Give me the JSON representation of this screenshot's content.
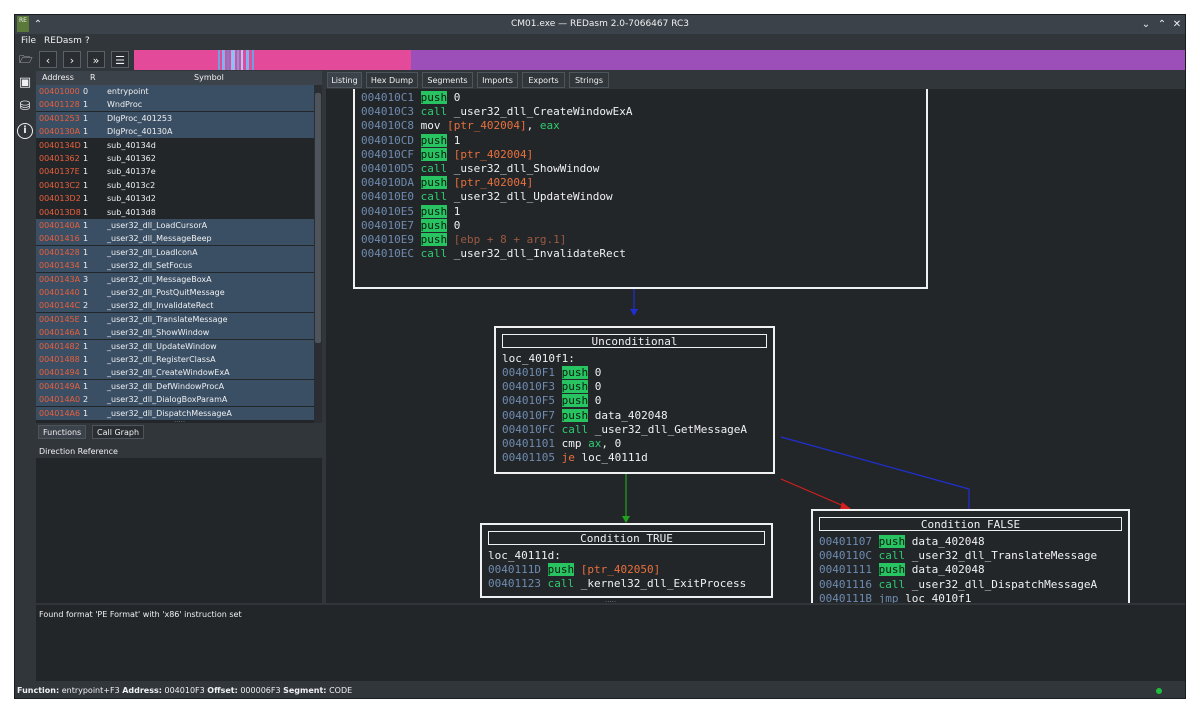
{
  "window": {
    "title": "CM01.exe — REDasm 2.0-7066467 RC3"
  },
  "menu": {
    "file": "File",
    "redasm": "REDasm",
    "help": "?"
  },
  "symbols": {
    "headers": {
      "address": "Address",
      "r": "R",
      "symbol": "Symbol"
    },
    "rows": [
      {
        "address": "00401000",
        "r": "0",
        "symbol": "entrypoint",
        "selected": true
      },
      {
        "address": "00401128",
        "r": "1",
        "symbol": "WndProc",
        "selected": true
      },
      {
        "address": "00401253",
        "r": "1",
        "symbol": "DlgProc_401253",
        "selected": true
      },
      {
        "address": "0040130A",
        "r": "1",
        "symbol": "DlgProc_40130A",
        "selected": true
      },
      {
        "address": "0040134D",
        "r": "1",
        "symbol": "sub_40134d",
        "selected": false
      },
      {
        "address": "00401362",
        "r": "1",
        "symbol": "sub_401362",
        "selected": false
      },
      {
        "address": "0040137E",
        "r": "1",
        "symbol": "sub_40137e",
        "selected": false
      },
      {
        "address": "004013C2",
        "r": "1",
        "symbol": "sub_4013c2",
        "selected": false
      },
      {
        "address": "004013D2",
        "r": "1",
        "symbol": "sub_4013d2",
        "selected": false
      },
      {
        "address": "004013D8",
        "r": "1",
        "symbol": "sub_4013d8",
        "selected": false
      },
      {
        "address": "0040140A",
        "r": "1",
        "symbol": "_user32_dll_LoadCursorA",
        "selected": true
      },
      {
        "address": "00401416",
        "r": "1",
        "symbol": "_user32_dll_MessageBeep",
        "selected": true
      },
      {
        "address": "00401428",
        "r": "1",
        "symbol": "_user32_dll_LoadIconA",
        "selected": true
      },
      {
        "address": "00401434",
        "r": "1",
        "symbol": "_user32_dll_SetFocus",
        "selected": true
      },
      {
        "address": "0040143A",
        "r": "3",
        "symbol": "_user32_dll_MessageBoxA",
        "selected": true
      },
      {
        "address": "00401440",
        "r": "1",
        "symbol": "_user32_dll_PostQuitMessage",
        "selected": true
      },
      {
        "address": "0040144C",
        "r": "2",
        "symbol": "_user32_dll_InvalidateRect",
        "selected": true
      },
      {
        "address": "0040145E",
        "r": "1",
        "symbol": "_user32_dll_TranslateMessage",
        "selected": true
      },
      {
        "address": "0040146A",
        "r": "1",
        "symbol": "_user32_dll_ShowWindow",
        "selected": true
      },
      {
        "address": "00401482",
        "r": "1",
        "symbol": "_user32_dll_UpdateWindow",
        "selected": true
      },
      {
        "address": "00401488",
        "r": "1",
        "symbol": "_user32_dll_RegisterClassA",
        "selected": true
      },
      {
        "address": "00401494",
        "r": "1",
        "symbol": "_user32_dll_CreateWindowExA",
        "selected": true
      },
      {
        "address": "0040149A",
        "r": "1",
        "symbol": "_user32_dll_DefWindowProcA",
        "selected": true
      },
      {
        "address": "004014A0",
        "r": "2",
        "symbol": "_user32_dll_DialogBoxParamA",
        "selected": true
      },
      {
        "address": "004014A6",
        "r": "1",
        "symbol": "_user32_dll_DispatchMessageA",
        "selected": true
      }
    ]
  },
  "bottom_tabs": {
    "functions": "Functions",
    "callgraph": "Call Graph"
  },
  "reference": {
    "header": "Direction Reference"
  },
  "view_tabs": {
    "listing": "Listing",
    "hexdump": "Hex Dump",
    "segments": "Segments",
    "imports": "Imports",
    "exports": "Exports",
    "strings": "Strings"
  },
  "blocks": {
    "top": {
      "lines": [
        {
          "addr": "004010C1",
          "mn": "push",
          "ops": "0",
          "kind": "plain"
        },
        {
          "addr": "004010C3",
          "mn": "call",
          "ops": "_user32_dll_CreateWindowExA",
          "kind": "plain"
        },
        {
          "addr": "004010C8",
          "mn": "mov",
          "ops": "[ptr_402004]",
          "ops2": ", ",
          "ops3": "eax",
          "kind": "mov"
        },
        {
          "addr": "004010CD",
          "mn": "push",
          "ops": "1",
          "kind": "plain"
        },
        {
          "addr": "004010CF",
          "mn": "push",
          "ops": "[ptr_402004]",
          "kind": "mem"
        },
        {
          "addr": "004010D5",
          "mn": "call",
          "ops": "_user32_dll_ShowWindow",
          "kind": "plain"
        },
        {
          "addr": "004010DA",
          "mn": "push",
          "ops": "[ptr_402004]",
          "kind": "mem"
        },
        {
          "addr": "004010E0",
          "mn": "call",
          "ops": "_user32_dll_UpdateWindow",
          "kind": "plain"
        },
        {
          "addr": "004010E5",
          "mn": "push",
          "ops": "1",
          "kind": "plain"
        },
        {
          "addr": "004010E7",
          "mn": "push",
          "ops": "0",
          "kind": "plain"
        },
        {
          "addr": "004010E9",
          "mn": "push",
          "ops": "[ebp + 8 + arg.1]",
          "kind": "cmt"
        },
        {
          "addr": "004010EC",
          "mn": "call",
          "ops": "_user32_dll_InvalidateRect",
          "kind": "plain"
        }
      ]
    },
    "uncond": {
      "header": "Unconditional",
      "label": "loc_4010f1:",
      "lines": [
        {
          "addr": "004010F1",
          "mn": "push",
          "ops": "0",
          "kind": "plain"
        },
        {
          "addr": "004010F3",
          "mn": "push",
          "ops": "0",
          "kind": "plain"
        },
        {
          "addr": "004010F5",
          "mn": "push",
          "ops": "0",
          "kind": "plain"
        },
        {
          "addr": "004010F7",
          "mn": "push",
          "ops": "data_402048",
          "kind": "plain"
        },
        {
          "addr": "004010FC",
          "mn": "call",
          "ops": "_user32_dll_GetMessageA",
          "kind": "plain"
        },
        {
          "addr": "00401101",
          "mn": "cmp",
          "ops": "ax",
          "ops2": ", ",
          "ops3": "0",
          "kind": "cmp"
        },
        {
          "addr": "00401105",
          "mn": "je",
          "ops": "loc_40111d",
          "kind": "je"
        }
      ]
    },
    "ctrue": {
      "header": "Condition TRUE",
      "label": "loc_40111d:",
      "lines": [
        {
          "addr": "0040111D",
          "mn": "push",
          "ops": "[ptr_402050]",
          "kind": "mem"
        },
        {
          "addr": "00401123",
          "mn": "call",
          "ops": "_kernel32_dll_ExitProcess",
          "kind": "plain"
        }
      ]
    },
    "cfalse": {
      "header": "Condition FALSE",
      "lines": [
        {
          "addr": "00401107",
          "mn": "push",
          "ops": "data_402048",
          "kind": "plain"
        },
        {
          "addr": "0040110C",
          "mn": "call",
          "ops": "_user32_dll_TranslateMessage",
          "kind": "plain"
        },
        {
          "addr": "00401111",
          "mn": "push",
          "ops": "data_402048",
          "kind": "plain"
        },
        {
          "addr": "00401116",
          "mn": "call",
          "ops": "_user32_dll_DispatchMessageA",
          "kind": "plain"
        },
        {
          "addr": "0040111B",
          "mn": "jmp",
          "ops": "loc_4010f1",
          "kind": "jmp"
        }
      ]
    }
  },
  "log": {
    "message": "Found format 'PE Format' with 'x86' instruction set"
  },
  "status": {
    "function_label": "Function:",
    "function_value": "entrypoint+F3",
    "address_label": "Address:",
    "address_value": "004010F3",
    "offset_label": "Offset:",
    "offset_value": "000006F3",
    "segment_label": "Segment:",
    "segment_value": "CODE"
  },
  "colors": {
    "accent_selection": "#3a4e64",
    "push_highlight": "#27c461",
    "navstrip_code": "#e34b9a",
    "navstrip_data": "#9c4fb8",
    "edge_true": "#1fa31f",
    "edge_false": "#d21f1f",
    "edge_unconditional": "#1f2fd2"
  }
}
